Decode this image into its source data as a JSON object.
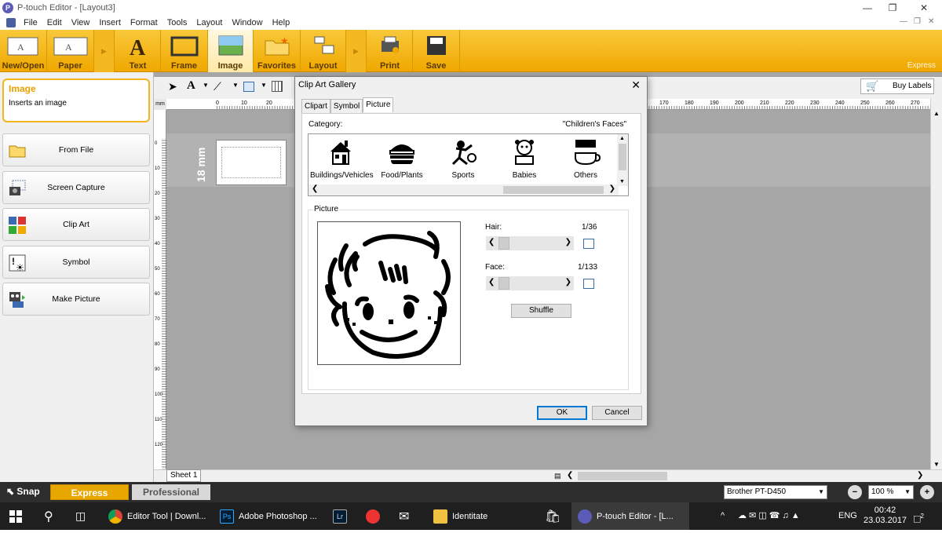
{
  "window": {
    "title": "P-touch Editor - [Layout3]",
    "app_icon": "P"
  },
  "menu": [
    "File",
    "Edit",
    "View",
    "Insert",
    "Format",
    "Tools",
    "Layout",
    "Window",
    "Help"
  ],
  "ribbon": {
    "buttons": [
      "New/Open",
      "Paper",
      "Text",
      "Frame",
      "Image",
      "Favorites",
      "Layout",
      "Print",
      "Save"
    ],
    "brand": "Express"
  },
  "toolstrip": {
    "buy_labels": "Buy Labels"
  },
  "left_panel": {
    "title": "Image",
    "desc": "Inserts an image",
    "buttons": [
      "From File",
      "Screen Capture",
      "Clip Art",
      "Symbol",
      "Make Picture"
    ]
  },
  "canvas": {
    "unit": "mm",
    "label_height": "18 mm",
    "sheet": "Sheet 1"
  },
  "ruler": {
    "h_ticks": [
      "0",
      "10",
      "20",
      "170",
      "180",
      "190",
      "200",
      "210",
      "220",
      "230",
      "240",
      "250",
      "260",
      "270"
    ],
    "v_ticks": [
      "0",
      "10",
      "20",
      "30",
      "40",
      "50",
      "60",
      "70",
      "80",
      "90",
      "100",
      "110",
      "120"
    ]
  },
  "bottom": {
    "snap": "Snap",
    "express": "Express",
    "professional": "Professional",
    "printer": "Brother PT-D450",
    "zoom": "100 %"
  },
  "dialog": {
    "title": "Clip Art Gallery",
    "tabs": [
      "Clipart",
      "Symbol",
      "Picture"
    ],
    "active_tab": "Picture",
    "category_label": "Category:",
    "category_value": "\"Children's Faces\"",
    "categories": [
      "Buildings/Vehicles",
      "Food/Plants",
      "Sports",
      "Babies",
      "Others"
    ],
    "picture_group": "Picture",
    "hair_label": "Hair:",
    "hair_value": "1/36",
    "face_label": "Face:",
    "face_value": "1/133",
    "shuffle": "Shuffle",
    "ok": "OK",
    "cancel": "Cancel"
  },
  "taskbar": {
    "items": [
      "Editor Tool | Downl...",
      "Adobe Photoshop ...",
      "Identitate",
      "P-touch Editor - [L..."
    ],
    "lang": "ENG",
    "time": "00:42",
    "date": "23.03.2017",
    "notif": "2"
  }
}
